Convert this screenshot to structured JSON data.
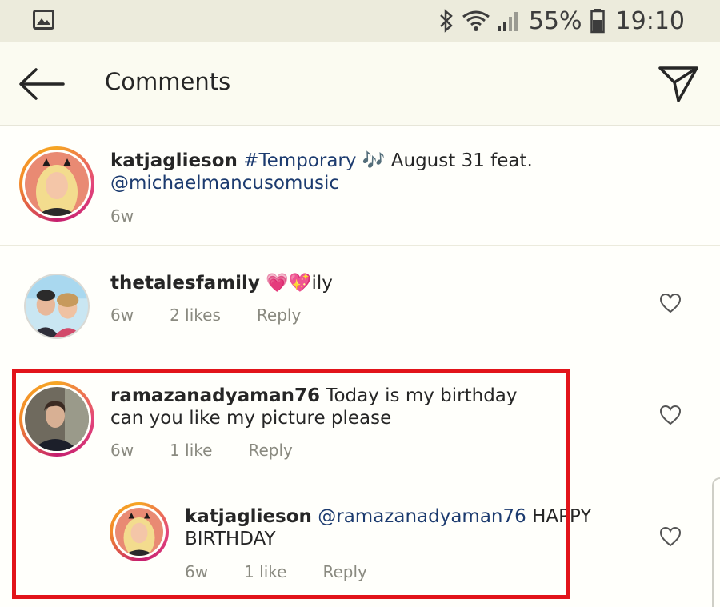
{
  "status_bar": {
    "battery_percent": "55%",
    "time": "19:10",
    "icons": [
      "gallery-icon",
      "bluetooth-icon",
      "wifi-icon",
      "signal-icon",
      "battery-icon"
    ]
  },
  "header": {
    "title": "Comments",
    "back_icon": "back-arrow-icon",
    "send_icon": "direct-send-icon"
  },
  "caption": {
    "username": "katjaglieson",
    "hashtag": "#Temporary",
    "emoji": "🎶",
    "text": "August 31 feat.",
    "mention": "@michaelmancusomusic",
    "age": "6w"
  },
  "comments": [
    {
      "username": "thetalesfamily",
      "emoji": "💗💖",
      "text": "ily",
      "age": "6w",
      "likes": "2 likes",
      "reply_label": "Reply"
    },
    {
      "username": "ramazanadyaman76",
      "text_line1": "Today is my birthday",
      "text_line2": "can you like my picture please",
      "age": "6w",
      "likes": "1 like",
      "reply_label": "Reply"
    }
  ],
  "reply": {
    "username": "katjaglieson",
    "mention": "@ramazanadyaman76",
    "text_line1": "HAPPY",
    "text_line2": "BIRTHDAY",
    "age": "6w",
    "likes": "1 like",
    "reply_label": "Reply"
  },
  "colors": {
    "highlight": "#e2141a",
    "link": "#1c3b6f",
    "meta": "#8a8a80",
    "header_bg": "#fbfbf1"
  }
}
